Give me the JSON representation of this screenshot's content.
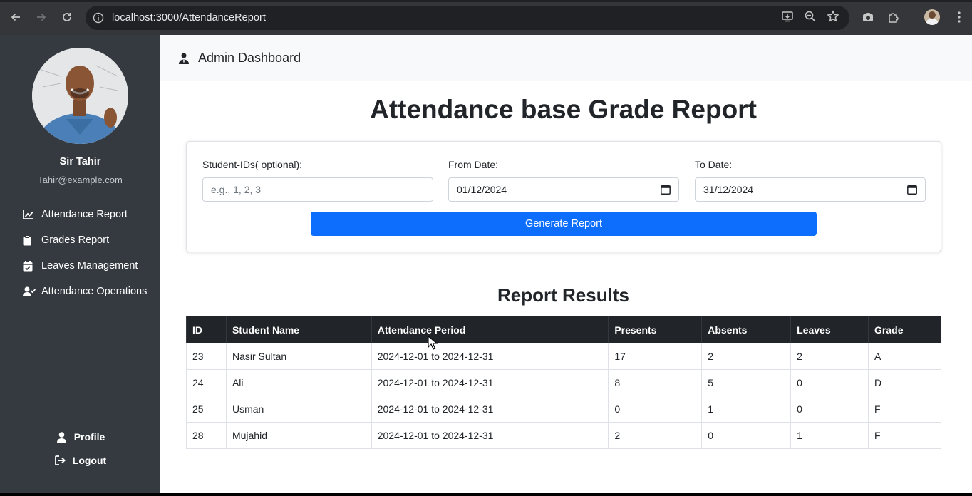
{
  "browser": {
    "url": "localhost:3000/AttendanceReport"
  },
  "sidebar": {
    "name": "Sir Tahir",
    "email": "Tahir@example.com",
    "items": [
      {
        "label": "Attendance Report",
        "icon": "chart-line-icon"
      },
      {
        "label": "Grades Report",
        "icon": "clipboard-icon"
      },
      {
        "label": "Leaves Management",
        "icon": "calendar-check-icon"
      },
      {
        "label": "Attendance Operations",
        "icon": "user-check-icon"
      }
    ],
    "profile_label": "Profile",
    "logout_label": "Logout"
  },
  "header": {
    "title": "Admin Dashboard"
  },
  "page": {
    "title": "Attendance base Grade Report"
  },
  "form": {
    "student_ids_label": "Student-IDs( optional):",
    "student_ids_placeholder": "e.g., 1, 2, 3",
    "from_label": "From Date:",
    "from_value": "01/12/2024",
    "to_label": "To Date:",
    "to_value": "31/12/2024",
    "button_label": "Generate Report"
  },
  "results": {
    "title": "Report Results",
    "columns": [
      "ID",
      "Student Name",
      "Attendance Period",
      "Presents",
      "Absents",
      "Leaves",
      "Grade"
    ],
    "rows": [
      [
        "23",
        "Nasir Sultan",
        "2024-12-01 to 2024-12-31",
        "17",
        "2",
        "2",
        "A"
      ],
      [
        "24",
        "Ali",
        "2024-12-01 to 2024-12-31",
        "8",
        "5",
        "0",
        "D"
      ],
      [
        "25",
        "Usman",
        "2024-12-01 to 2024-12-31",
        "0",
        "1",
        "0",
        "F"
      ],
      [
        "28",
        "Mujahid",
        "2024-12-01 to 2024-12-31",
        "2",
        "0",
        "1",
        "F"
      ]
    ]
  },
  "colors": {
    "sidebar_bg": "#343a40",
    "primary": "#0d6efd",
    "table_header": "#212529"
  }
}
